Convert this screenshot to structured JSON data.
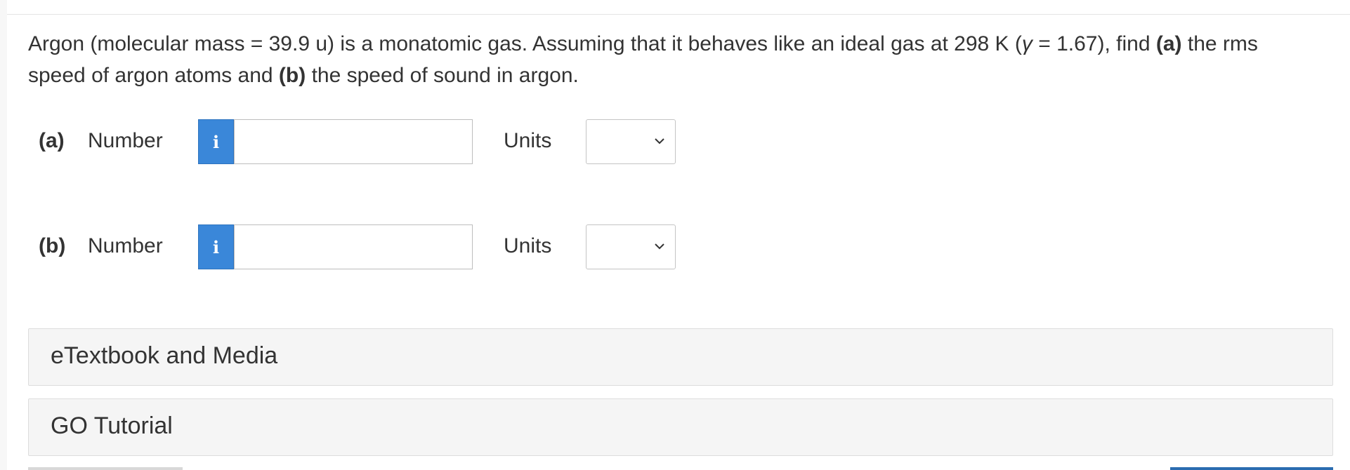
{
  "question": {
    "part1": "Argon (molecular mass = 39.9 u) is a monatomic gas. Assuming that it behaves like an ideal gas at 298 K (",
    "gamma_symbol": "γ",
    "part2": " = 1.67), find ",
    "label_a": "(a)",
    "part3": " the rms speed of argon atoms and ",
    "label_b": "(b)",
    "part4": " the speed of sound in argon."
  },
  "rows": [
    {
      "part": "(a)",
      "number_label": "Number",
      "info_icon": "i",
      "value": "",
      "units_label": "Units",
      "units_value": ""
    },
    {
      "part": "(b)",
      "number_label": "Number",
      "info_icon": "i",
      "value": "",
      "units_label": "Units",
      "units_value": ""
    }
  ],
  "accordion": [
    {
      "label": "eTextbook and Media"
    },
    {
      "label": "GO Tutorial"
    }
  ],
  "colors": {
    "info_button": "#3a87d9",
    "text": "#333333",
    "panel_bg": "#f5f5f5"
  }
}
